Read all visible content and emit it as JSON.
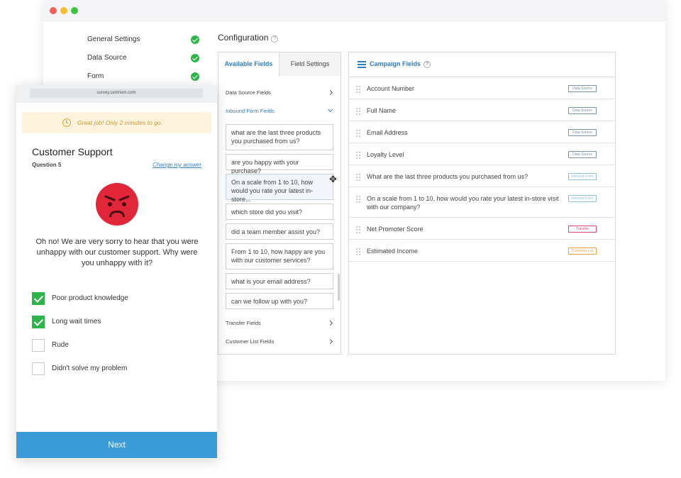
{
  "steps": [
    {
      "label": "General Settings"
    },
    {
      "label": "Data Source"
    },
    {
      "label": "Form"
    }
  ],
  "configuration": {
    "title": "Configuration"
  },
  "available": {
    "tabs": [
      {
        "label": "Available Fields"
      },
      {
        "label": "Field Settings"
      }
    ],
    "sections": {
      "data_source": "Data Source Fields",
      "inbound": "Inbound Form Fields",
      "transfer": "Transfer Fields",
      "customer_list": "Customer List Fields"
    },
    "inbound_fields": [
      "what are the last three products you purchased from us?",
      "are you happy with your purchase?",
      "On a scale from 1 to 10, how would you rate your latest in-store...",
      "which store did you visit?",
      "did a team member assist you?",
      "From 1 to 10, how happy are you with our customer services?",
      "what is your email address?",
      "can we follow up with you?"
    ]
  },
  "campaign": {
    "title": "Campaign Fields",
    "rows": [
      {
        "label": "Account Number",
        "badge": "Data Source",
        "color": "#7b8fa6"
      },
      {
        "label": "Full Name",
        "badge": "Data Source",
        "color": "#7b8fa6"
      },
      {
        "label": "Email Address",
        "badge": "Data Source",
        "color": "#7b8fa6"
      },
      {
        "label": "Loyalty Level",
        "badge": "Data Source",
        "color": "#7b8fa6"
      },
      {
        "label": "What are the last three products you purchased from us?",
        "badge": "Inbound Form",
        "color": "#8fc1e6"
      },
      {
        "label": "On a scale from 1 to 10, how would you rate your latest in-store visit with our company?",
        "badge": "Inbound Form",
        "color": "#8fc1e6"
      },
      {
        "label": "Net Promoter Score",
        "badge": "Transfer",
        "color": "#d9457a"
      },
      {
        "label": "Estimated Income",
        "badge": "Customer List",
        "color": "#f0a24a"
      }
    ]
  },
  "mobile": {
    "url": "survey.centriam.com",
    "notice": "Great job! Only 2 minutes to go.",
    "title": "Customer Support",
    "question_number": "Question 5",
    "change_link": "Change my answer",
    "question": "Oh no! We are very sorry to hear that you were unhappy with our customer support. Why were you unhappy with it?",
    "options": [
      {
        "label": "Poor product knowledge",
        "checked": true
      },
      {
        "label": "Long wait times",
        "checked": true
      },
      {
        "label": "Rude",
        "checked": false
      },
      {
        "label": "Didn't solve my problem",
        "checked": false
      }
    ],
    "next": "Next"
  },
  "colors": {
    "accent": "#2f7cc1",
    "success": "#2fb44a",
    "next_button": "#3a9bd8",
    "angry_face": "#e2263a"
  }
}
